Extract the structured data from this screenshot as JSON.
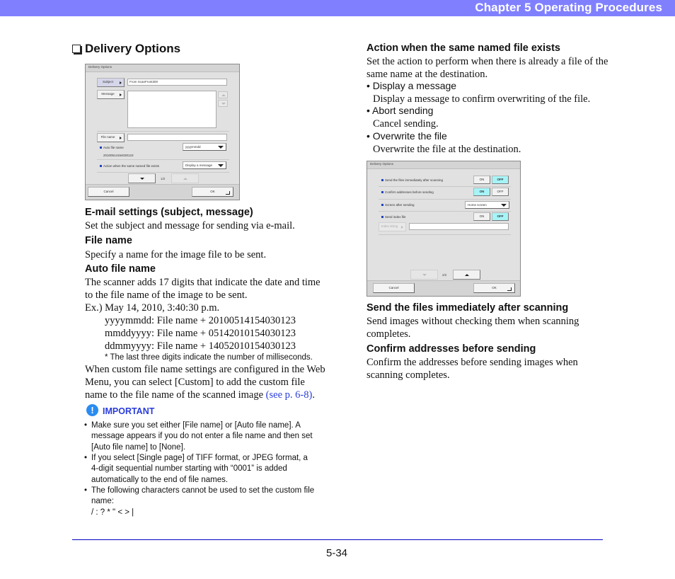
{
  "header": {
    "title": "Chapter 5   Operating Procedures",
    "bar_color": "#8080ff"
  },
  "section": {
    "title": "Delivery Options"
  },
  "screen1": {
    "title": "Delivery Options",
    "subject_button": "Subject",
    "subject_value": "From ScanFront300",
    "message_button": "Message",
    "message_value": "",
    "file_name_button": "File name",
    "file_name_value": "",
    "auto_file_name_label": "Auto file name",
    "auto_file_name_value": "yyyymmdd",
    "auto_file_name_example": "20100514154030123",
    "action_label": "Action when the same named file exists",
    "action_value": "Display a message",
    "page_indicator": "1/2",
    "cancel_button": "Cancel",
    "ok_button": "OK"
  },
  "screen2": {
    "title": "Delivery Options",
    "rows": [
      {
        "label": "Send the files immediately after scanning",
        "on": "ON",
        "off": "OFF",
        "selected": "OFF"
      },
      {
        "label": "Confirm addresses before sending",
        "on": "ON",
        "off": "OFF",
        "selected": "ON"
      },
      {
        "label": "Screen after sending",
        "select_value": "Home screen"
      },
      {
        "label": "Send index file",
        "on": "ON",
        "off": "OFF",
        "selected": "OFF"
      }
    ],
    "index_string_button": "Index string",
    "index_string_value": "",
    "page_indicator": "2/2",
    "cancel_button": "Cancel",
    "ok_button": "OK"
  },
  "left": {
    "email_heading": "E-mail settings (subject, message)",
    "email_text": "Set the subject and message for sending via e-mail.",
    "filename_heading": "File name",
    "filename_text": "Specify a name for the image file to be sent.",
    "auto_heading": "Auto file name",
    "auto_text_1": "The scanner adds 17 digits that indicate the date and time",
    "auto_text_2": "to the file name of the image to be sent.",
    "example_intro": "Ex.) May 14, 2010, 3:40:30 p.m.",
    "example_lines": [
      "yyyymmdd: File name + 20100514154030123",
      "mmddyyyy: File name + 05142010154030123",
      "ddmmyyyy: File name + 14052010154030123"
    ],
    "ms_note": "* The last three digits indicate the number of milliseconds.",
    "custom_1": "When custom file name settings are configured in the Web",
    "custom_2": "Menu, you can select [Custom] to add the custom file",
    "custom_3": "name to the file name of the scanned image ",
    "custom_link": "(see p. 6-8)",
    "custom_end": "."
  },
  "important": {
    "label": "IMPORTANT",
    "icon": "exclamation-icon",
    "items": [
      [
        "Make sure you set either [File name] or [Auto file name]. A",
        "message appears if you do not enter a file name and then set",
        "[Auto file name] to [None]."
      ],
      [
        "If you select [Single page] of TIFF format, or JPEG format, a",
        "4-digit sequential number starting with “0001” is added",
        "automatically to the end of file names."
      ],
      [
        "The following characters cannot be used to set the custom file",
        "name:",
        "/ : ? * \" < > |"
      ]
    ]
  },
  "right": {
    "action_heading": "Action when the same named file exists",
    "action_text_1": "Set the action to perform when there is already a file of the",
    "action_text_2": "same name at the destination.",
    "options": [
      {
        "label": "Display a message",
        "desc": "Display a message to confirm overwriting of the file."
      },
      {
        "label": "Abort sending",
        "desc": "Cancel sending."
      },
      {
        "label": "Overwrite the file",
        "desc": "Overwrite the file at the destination."
      }
    ],
    "send_heading": "Send the files immediately after scanning",
    "send_text_1": "Send images without checking them when scanning",
    "send_text_2": "completes.",
    "confirm_heading": "Confirm addresses before sending",
    "confirm_text_1": "Confirm the addresses before sending images when",
    "confirm_text_2": "scanning completes."
  },
  "footer": {
    "page_number": "5-34"
  }
}
